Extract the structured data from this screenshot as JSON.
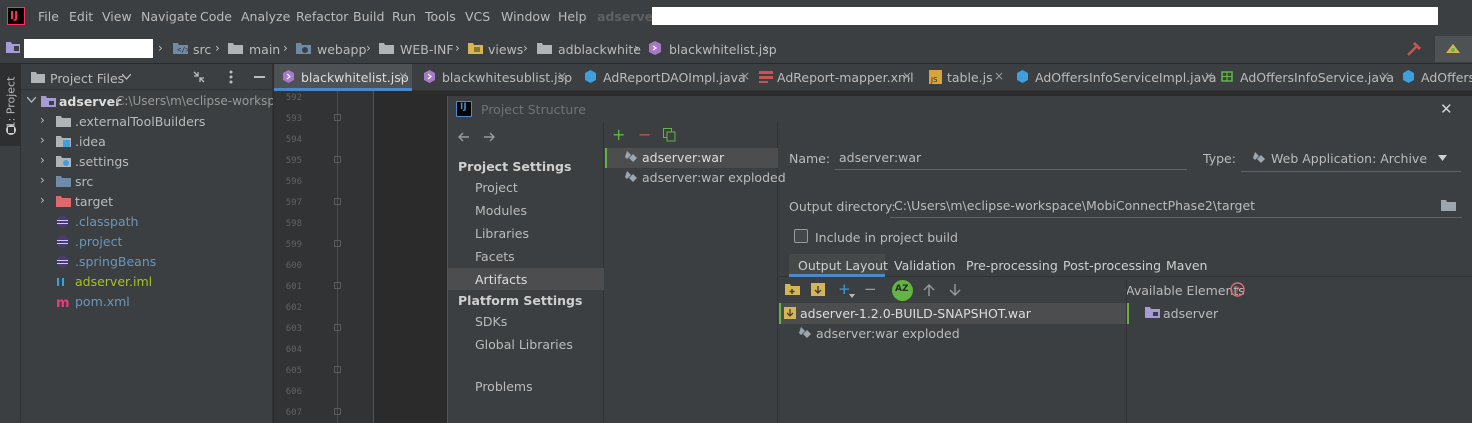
{
  "menubar": {
    "logo_text": "IJ",
    "items": [
      "File",
      "Edit",
      "View",
      "Navigate",
      "Code",
      "Analyze",
      "Refactor",
      "Build",
      "Run",
      "Tools",
      "VCS",
      "Window",
      "Help"
    ],
    "project_name": "adserver"
  },
  "breadcrumbs": [
    "src",
    "main",
    "webapp",
    "WEB-INF",
    "views",
    "adblackwhite",
    "blackwhitelist.jsp"
  ],
  "toolstrip": {
    "project_tab": "1: Project"
  },
  "project_panel": {
    "title": "Project Files",
    "root": {
      "name": "adserver",
      "path": "C:\\Users\\m\\eclipse-worksp"
    },
    "items": [
      {
        "label": ".externalToolBuilders",
        "icon": "folder-icon",
        "color": "#bbbbbb"
      },
      {
        "label": ".idea",
        "icon": "idea-folder-icon",
        "color": "#bbbbbb"
      },
      {
        "label": ".settings",
        "icon": "settings-folder-icon",
        "color": "#bbbbbb"
      },
      {
        "label": "src",
        "icon": "source-folder-icon",
        "color": "#bbbbbb"
      },
      {
        "label": "target",
        "icon": "target-folder-icon",
        "color": "#bbbbbb"
      },
      {
        "label": ".classpath",
        "icon": "eclipse-file-icon",
        "color": "#6897bb"
      },
      {
        "label": ".project",
        "icon": "eclipse-file-icon",
        "color": "#6897bb"
      },
      {
        "label": ".springBeans",
        "icon": "eclipse-file-icon",
        "color": "#6897bb"
      },
      {
        "label": "adserver.iml",
        "icon": "iml-file-icon",
        "color": "#a8c023"
      },
      {
        "label": "pom.xml",
        "icon": "maven-file-icon",
        "color": "#6897bb"
      }
    ]
  },
  "editor_tabs": [
    {
      "label": "blackwhitelist.jsp",
      "icon": "jsp-icon"
    },
    {
      "label": "blackwhitesublist.jsp",
      "icon": "jsp-icon"
    },
    {
      "label": "AdReportDAOImpl.java",
      "icon": "java-class-icon"
    },
    {
      "label": "AdReport-mapper.xml",
      "icon": "xml-icon"
    },
    {
      "label": "table.js",
      "icon": "js-icon"
    },
    {
      "label": "AdOffersInfoServiceImpl.java",
      "icon": "java-class-icon"
    },
    {
      "label": "AdOffersInfoService.java",
      "icon": "java-interface-icon"
    },
    {
      "label": "AdOffersI",
      "icon": "java-class-icon"
    }
  ],
  "gutter": {
    "line_numbers": [
      "592",
      "593",
      "594",
      "595",
      "596",
      "597",
      "598",
      "599",
      "600",
      "601",
      "602",
      "603",
      "604",
      "605",
      "606",
      "607"
    ]
  },
  "dialog": {
    "title": "Project Structure",
    "icon_text": "IJ",
    "project_settings_header": "Project Settings",
    "project_settings": [
      "Project",
      "Modules",
      "Libraries",
      "Facets",
      "Artifacts"
    ],
    "platform_settings_header": "Platform Settings",
    "platform_settings": [
      "SDKs",
      "Global Libraries"
    ],
    "problems": "Problems",
    "artifacts": [
      "adserver:war",
      "adserver:war exploded"
    ],
    "name_label": "Name:",
    "name_value": "adserver:war",
    "type_label": "Type:",
    "type_value": "Web Application: Archive",
    "output_dir_label": "Output directory:",
    "output_dir_value": "C:\\Users\\m\\eclipse-workspace\\MobiConnectPhase2\\target",
    "include_label": "Include in project build",
    "include_checked": false,
    "layout_tabs": [
      "Output Layout",
      "Validation",
      "Pre-processing",
      "Post-processing",
      "Maven"
    ],
    "available_elements_label": "Available Elements",
    "output_tree": [
      "adserver-1.2.0-BUILD-SNAPSHOT.war",
      "adserver:war exploded"
    ],
    "available_tree": [
      "adserver"
    ]
  }
}
